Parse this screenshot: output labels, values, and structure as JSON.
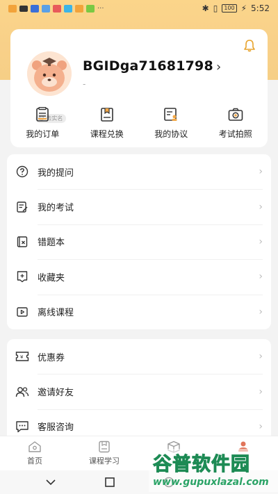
{
  "status_bar": {
    "time": "5:52",
    "battery": "100"
  },
  "profile": {
    "username": "BGIDga71681798",
    "subtitle": "-",
    "realname_tag": "去实名",
    "bell_icon": "bell-icon"
  },
  "quick_actions": [
    {
      "label": "我的订单",
      "icon": "order-icon"
    },
    {
      "label": "课程兑换",
      "icon": "course-redeem-icon"
    },
    {
      "label": "我的协议",
      "icon": "agreement-icon"
    },
    {
      "label": "考试拍照",
      "icon": "camera-icon"
    }
  ],
  "menu_group_1": [
    {
      "label": "我的提问",
      "icon": "question-icon"
    },
    {
      "label": "我的考试",
      "icon": "exam-icon"
    },
    {
      "label": "错题本",
      "icon": "wrong-book-icon"
    },
    {
      "label": "收藏夹",
      "icon": "favorites-icon"
    },
    {
      "label": "离线课程",
      "icon": "offline-course-icon"
    }
  ],
  "menu_group_2": [
    {
      "label": "优惠券",
      "icon": "coupon-icon"
    },
    {
      "label": "邀请好友",
      "icon": "invite-friends-icon"
    },
    {
      "label": "客服咨询",
      "icon": "customer-service-icon"
    }
  ],
  "tabbar": [
    {
      "label": "首页",
      "icon": "home-icon"
    },
    {
      "label": "课程学习",
      "icon": "course-study-icon"
    },
    {
      "label": "",
      "icon": "box-icon"
    },
    {
      "label": "",
      "icon": "profile-icon"
    }
  ],
  "watermark": {
    "title": "谷普软件园",
    "url": "www.gupuxlazal.com"
  },
  "colors": {
    "header_gradient": "#fbd58a",
    "accent": "#e0745a",
    "watermark_green": "#2bb673"
  }
}
